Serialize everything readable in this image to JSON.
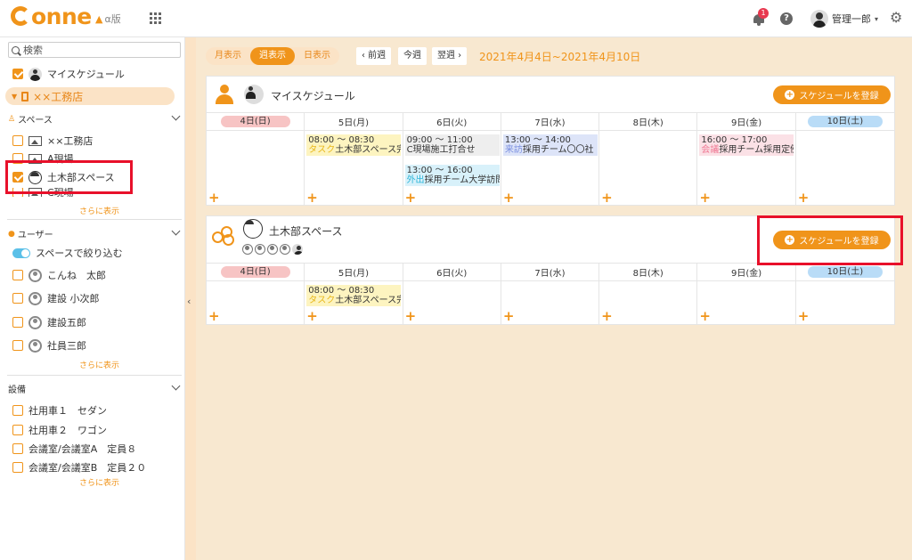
{
  "header": {
    "logo": "onne",
    "alpha_label": "α版",
    "notification_count": "1",
    "help_label": "?",
    "user_name": "管理一郎",
    "caret": "▾",
    "gear": "⚙"
  },
  "sidebar": {
    "search_placeholder": "検索",
    "my_schedule": "マイスケジュール",
    "store": "××工務店",
    "spaces_title": "スペース",
    "spaces": [
      "××工務店",
      "A現場",
      "土木部スペース",
      "C現場"
    ],
    "spaces_more": "さらに表示",
    "users_title": "ユーザー",
    "filter_by_space": "スペースで絞り込む",
    "users": [
      "こんね　太郎",
      "建設 小次郎",
      "建設五郎",
      "社員三郎"
    ],
    "users_more": "さらに表示",
    "equipment_title": "設備",
    "equipment": [
      "社用車１　セダン",
      "社用車２　ワゴン",
      "会議室/会議室A　定員８",
      "会議室/会議室B　定員２０"
    ],
    "equipment_more": "さらに表示",
    "collapse_arrow": "‹"
  },
  "toolbar": {
    "views": [
      "月表示",
      "週表示",
      "日表示"
    ],
    "prev": "‹ 前週",
    "today": "今週",
    "next": "翌週 ›",
    "range": "2021年4月4日~2021年4月10日"
  },
  "days": [
    "4日(日)",
    "5日(月)",
    "6日(火)",
    "7日(水)",
    "8日(木)",
    "9日(金)",
    "10日(土)"
  ],
  "cards": {
    "my": {
      "title": "マイスケジュール",
      "register": "スケジュールを登録",
      "events": [
        {
          "time": "08:00 ～ 08:30",
          "tag": "タスク",
          "text": "土木部スペース完"
        },
        {
          "time": "09:00 ～ 11:00",
          "tag": "",
          "text": "C現場施工打合せ"
        },
        {
          "time": "13:00 ～ 16:00",
          "tag": "外出",
          "text": "採用チーム大学訪問"
        },
        {
          "time": "13:00 ～ 14:00",
          "tag": "来訪",
          "text": "採用チーム〇〇社"
        },
        {
          "time": "16:00 ～ 17:00",
          "tag": "会議",
          "text": "採用チーム採用定例"
        }
      ]
    },
    "space": {
      "title": "土木部スペース",
      "register": "スケジュールを登録",
      "events": [
        {
          "time": "08:00 ～ 08:30",
          "tag": "タスク",
          "text": "土木部スペース完"
        }
      ]
    }
  },
  "plus": "+",
  "plus_small": "+",
  "colors": {
    "accent": "#f0941a",
    "highlight": "#e8102a"
  }
}
